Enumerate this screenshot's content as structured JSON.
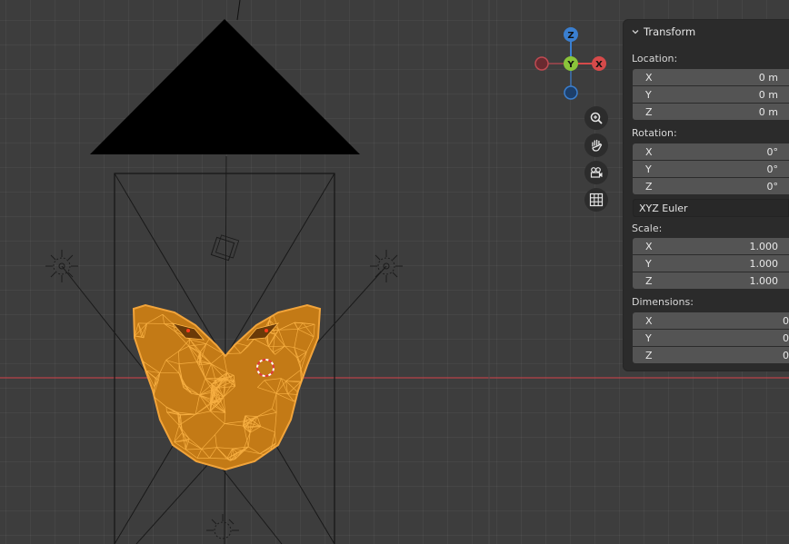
{
  "colors": {
    "viewport_bg": "#3d3d3d",
    "selection_orange": "#f0a030",
    "x_axis_red": "#d64a4a",
    "y_axis_green": "#8ac43a",
    "z_axis_blue": "#3a7fd0",
    "panel_bg": "#2b2b2b",
    "field_bg": "#545454"
  },
  "gizmo": {
    "z_label": "Z",
    "y_label": "Y",
    "x_label": "X"
  },
  "nav_buttons": [
    {
      "name": "zoom-icon"
    },
    {
      "name": "hand-pan-icon"
    },
    {
      "name": "camera-view-icon"
    },
    {
      "name": "grid-ortho-icon"
    }
  ],
  "panel": {
    "title": "Transform",
    "location": {
      "label": "Location:",
      "rows": [
        {
          "axis": "X",
          "value": "0 m"
        },
        {
          "axis": "Y",
          "value": "0 m"
        },
        {
          "axis": "Z",
          "value": "0 m"
        }
      ]
    },
    "rotation": {
      "label": "Rotation:",
      "rows": [
        {
          "axis": "X",
          "value": "0°"
        },
        {
          "axis": "Y",
          "value": "0°"
        },
        {
          "axis": "Z",
          "value": "0°"
        }
      ],
      "mode": "XYZ Euler"
    },
    "scale": {
      "label": "Scale:",
      "rows": [
        {
          "axis": "X",
          "value": "1.000"
        },
        {
          "axis": "Y",
          "value": "1.000"
        },
        {
          "axis": "Z",
          "value": "1.000"
        }
      ]
    },
    "dimensions": {
      "label": "Dimensions:",
      "rows": [
        {
          "axis": "X",
          "value": "0"
        },
        {
          "axis": "Y",
          "value": "0"
        },
        {
          "axis": "Z",
          "value": "0"
        }
      ]
    }
  }
}
